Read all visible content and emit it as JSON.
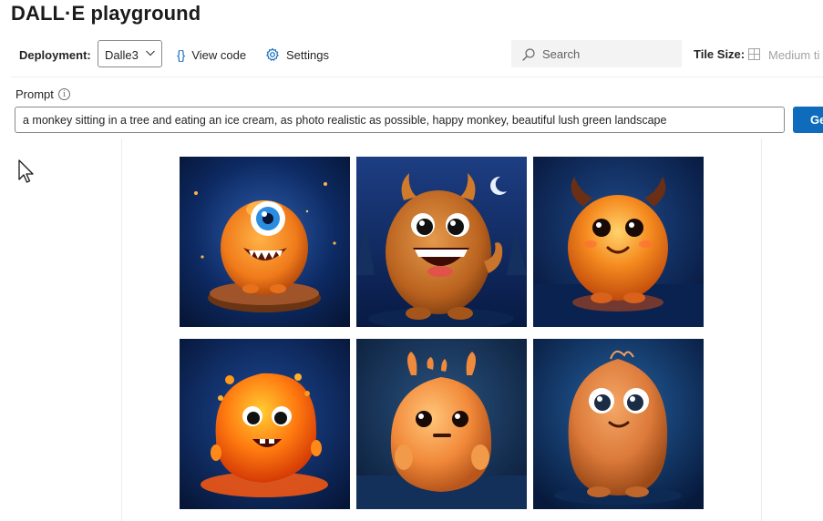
{
  "app_title": "DALL·E playground",
  "toolbar": {
    "deployment_label": "Deployment:",
    "deployment_value": "Dalle3",
    "view_code_label": "View code",
    "settings_label": "Settings",
    "search_placeholder": "Search",
    "tile_size_label": "Tile Size:",
    "tile_size_value": "Medium ti"
  },
  "prompt": {
    "label": "Prompt",
    "value": "a monkey sitting in a tree and eating an ice cream, as photo realistic as possible, happy monkey, beautiful lush green landscape",
    "generate_label": "Generate"
  },
  "gallery": {
    "images": [
      {
        "subject": "orange one-eyed furry monster on wooden base"
      },
      {
        "subject": "brown horned furry monster giving thumbs up"
      },
      {
        "subject": "glowing orange horned monster"
      },
      {
        "subject": "melting lava orange monster"
      },
      {
        "subject": "smooth orange antenna monster"
      },
      {
        "subject": "fluffy orange furry monster"
      }
    ]
  },
  "colors": {
    "accent": "#0f6cbd",
    "image_background": "#0a1f4a",
    "monster_orange": "#f07a1a"
  },
  "icons": {
    "view_code": "braces-icon",
    "settings": "gear-icon",
    "search": "search-icon",
    "tile_size": "grid-icon",
    "info": "info-icon",
    "cursor": "mouse-pointer-icon"
  }
}
